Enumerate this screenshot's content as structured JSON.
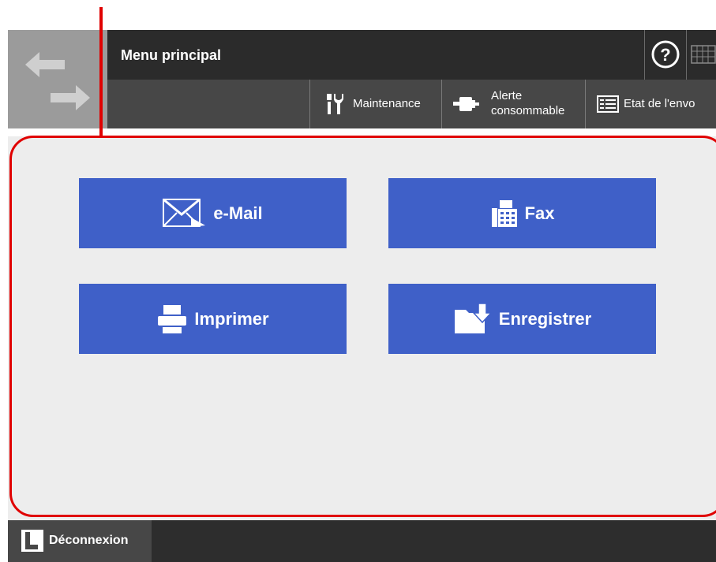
{
  "header": {
    "title": "Menu principal",
    "help_icon": "question-circle-icon",
    "keyboard_icon": "keyboard-icon"
  },
  "toolbar": {
    "maintenance_label": "Maintenance",
    "consumable_alert_line1": "Alerte",
    "consumable_alert_line2": "consommable",
    "send_status_label": "Etat de l'envo"
  },
  "menu": {
    "email_label": "e-Mail",
    "fax_label": "Fax",
    "print_label": "Imprimer",
    "save_label": "Enregistrer"
  },
  "footer": {
    "logout_label": "Déconnexion"
  },
  "colors": {
    "accent_button": "#3f60c8",
    "title_bar": "#2b2b2b",
    "toolbar": "#474747",
    "highlight": "#e00000",
    "panel": "#ededed"
  }
}
